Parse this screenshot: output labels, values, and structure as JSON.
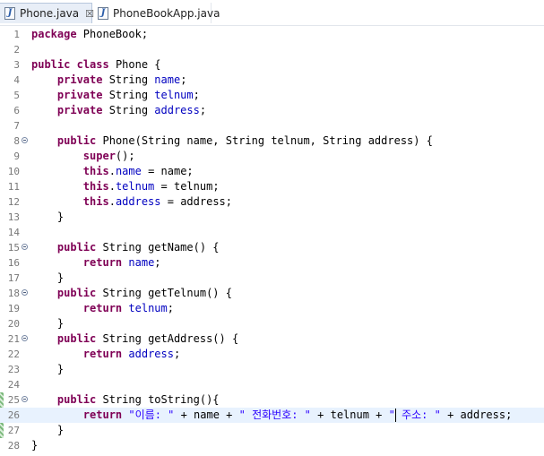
{
  "tabs": [
    {
      "label": "Phone.java",
      "active": true,
      "close": "☒"
    },
    {
      "label": "PhoneBookApp.java",
      "active": false
    }
  ],
  "editor": {
    "current_line": 26,
    "lines": [
      {
        "n": "1",
        "tokens": [
          [
            "kw",
            "package"
          ],
          [
            "t",
            " PhoneBook;"
          ]
        ]
      },
      {
        "n": "2",
        "tokens": []
      },
      {
        "n": "3",
        "tokens": [
          [
            "kw",
            "public"
          ],
          [
            "t",
            " "
          ],
          [
            "kw",
            "class"
          ],
          [
            "t",
            " Phone {"
          ]
        ]
      },
      {
        "n": "4",
        "tokens": [
          [
            "t",
            "    "
          ],
          [
            "kw",
            "private"
          ],
          [
            "t",
            " String "
          ],
          [
            "fld",
            "name"
          ],
          [
            "t",
            ";"
          ]
        ]
      },
      {
        "n": "5",
        "tokens": [
          [
            "t",
            "    "
          ],
          [
            "kw",
            "private"
          ],
          [
            "t",
            " String "
          ],
          [
            "fld",
            "telnum"
          ],
          [
            "t",
            ";"
          ]
        ]
      },
      {
        "n": "6",
        "tokens": [
          [
            "t",
            "    "
          ],
          [
            "kw",
            "private"
          ],
          [
            "t",
            " String "
          ],
          [
            "fld",
            "address"
          ],
          [
            "t",
            ";"
          ]
        ]
      },
      {
        "n": "7",
        "tokens": []
      },
      {
        "n": "8",
        "fold": true,
        "tokens": [
          [
            "t",
            "    "
          ],
          [
            "kw",
            "public"
          ],
          [
            "t",
            " Phone(String name, String telnum, String address) {"
          ]
        ]
      },
      {
        "n": "9",
        "tokens": [
          [
            "t",
            "        "
          ],
          [
            "kw",
            "super"
          ],
          [
            "t",
            "();"
          ]
        ]
      },
      {
        "n": "10",
        "tokens": [
          [
            "t",
            "        "
          ],
          [
            "kw",
            "this"
          ],
          [
            "t",
            "."
          ],
          [
            "fld",
            "name"
          ],
          [
            "t",
            " = name;"
          ]
        ]
      },
      {
        "n": "11",
        "tokens": [
          [
            "t",
            "        "
          ],
          [
            "kw",
            "this"
          ],
          [
            "t",
            "."
          ],
          [
            "fld",
            "telnum"
          ],
          [
            "t",
            " = telnum;"
          ]
        ]
      },
      {
        "n": "12",
        "tokens": [
          [
            "t",
            "        "
          ],
          [
            "kw",
            "this"
          ],
          [
            "t",
            "."
          ],
          [
            "fld",
            "address"
          ],
          [
            "t",
            " = address;"
          ]
        ]
      },
      {
        "n": "13",
        "tokens": [
          [
            "t",
            "    }"
          ]
        ]
      },
      {
        "n": "14",
        "tokens": []
      },
      {
        "n": "15",
        "fold": true,
        "tokens": [
          [
            "t",
            "    "
          ],
          [
            "kw",
            "public"
          ],
          [
            "t",
            " String getName() {"
          ]
        ]
      },
      {
        "n": "16",
        "tokens": [
          [
            "t",
            "        "
          ],
          [
            "kw",
            "return"
          ],
          [
            "t",
            " "
          ],
          [
            "fld",
            "name"
          ],
          [
            "t",
            ";"
          ]
        ]
      },
      {
        "n": "17",
        "tokens": [
          [
            "t",
            "    }"
          ]
        ]
      },
      {
        "n": "18",
        "fold": true,
        "tokens": [
          [
            "t",
            "    "
          ],
          [
            "kw",
            "public"
          ],
          [
            "t",
            " String getTelnum() {"
          ]
        ]
      },
      {
        "n": "19",
        "tokens": [
          [
            "t",
            "        "
          ],
          [
            "kw",
            "return"
          ],
          [
            "t",
            " "
          ],
          [
            "fld",
            "telnum"
          ],
          [
            "t",
            ";"
          ]
        ]
      },
      {
        "n": "20",
        "tokens": [
          [
            "t",
            "    }"
          ]
        ]
      },
      {
        "n": "21",
        "fold": true,
        "tokens": [
          [
            "t",
            "    "
          ],
          [
            "kw",
            "public"
          ],
          [
            "t",
            " String getAddress() {"
          ]
        ]
      },
      {
        "n": "22",
        "tokens": [
          [
            "t",
            "        "
          ],
          [
            "kw",
            "return"
          ],
          [
            "t",
            " "
          ],
          [
            "fld",
            "address"
          ],
          [
            "t",
            ";"
          ]
        ]
      },
      {
        "n": "23",
        "tokens": [
          [
            "t",
            "    }"
          ]
        ]
      },
      {
        "n": "24",
        "tokens": []
      },
      {
        "n": "25",
        "fold": true,
        "marker": true,
        "tokens": [
          [
            "t",
            "    "
          ],
          [
            "kw",
            "public"
          ],
          [
            "t",
            " String toString(){"
          ]
        ]
      },
      {
        "n": "26",
        "tokens": [
          [
            "t",
            "        "
          ],
          [
            "kw",
            "return"
          ],
          [
            "t",
            " "
          ],
          [
            "str",
            "\"이름: \""
          ],
          [
            "t",
            " + name + "
          ],
          [
            "str",
            "\" 전화번호: \""
          ],
          [
            "t",
            " + telnum + "
          ],
          [
            "str",
            "\" 주소: \""
          ],
          [
            "t",
            " + address;"
          ]
        ]
      },
      {
        "n": "27",
        "marker": true,
        "tokens": [
          [
            "t",
            "    }"
          ]
        ]
      },
      {
        "n": "28",
        "tokens": [
          [
            "t",
            "}"
          ]
        ]
      }
    ]
  },
  "colors": {
    "keyword": "#7f0055",
    "field": "#0000c0",
    "string": "#2a00ff",
    "current_line_bg": "#e8f2fe"
  }
}
